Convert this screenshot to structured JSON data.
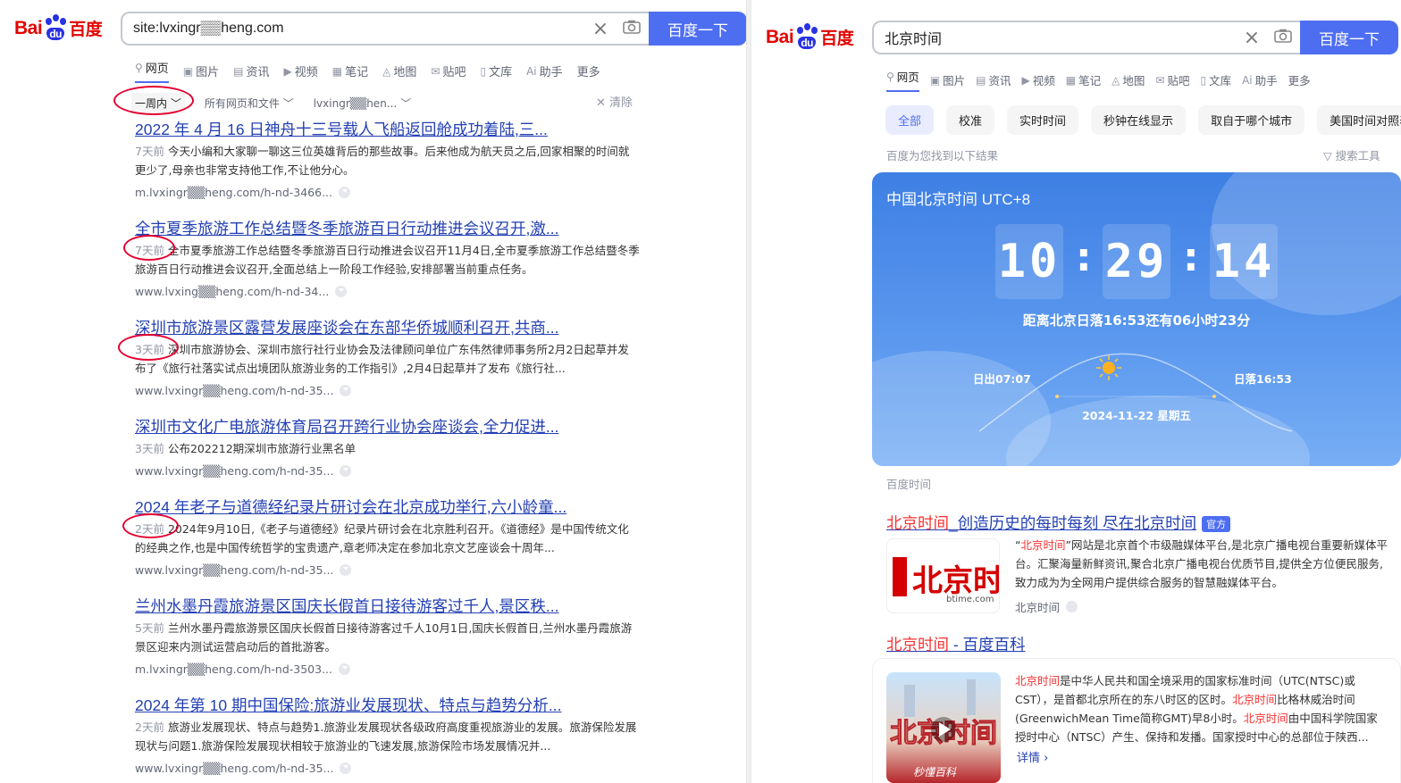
{
  "left": {
    "logo": {
      "bai": "Bai",
      "du": "du",
      "baidu": "百度"
    },
    "search": {
      "value": "site:lvxingr▒▒heng.com",
      "button": "百度一下"
    },
    "tabs": [
      {
        "icon": "○",
        "label": "网页",
        "active": true
      },
      {
        "icon": "▣",
        "label": "图片"
      },
      {
        "icon": "▤",
        "label": "资讯"
      },
      {
        "icon": "▶",
        "label": "视频"
      },
      {
        "icon": "▦",
        "label": "笔记"
      },
      {
        "icon": "◬",
        "label": "地图"
      },
      {
        "icon": "✉",
        "label": "贴吧"
      },
      {
        "icon": "▯",
        "label": "文库"
      },
      {
        "icon": "Ai",
        "label": "助手"
      },
      {
        "icon": "",
        "label": "更多"
      }
    ],
    "filters": {
      "time": "一周内",
      "scope": "所有网页和文件",
      "site": "lvxingr▒▒hen...",
      "clear": "清除"
    },
    "results": [
      {
        "title": "2022 年 4 月 16 日神舟十三号载人飞船返回舱成功着陆,三...",
        "ago": "7天前",
        "desc": "今天小编和大家聊一聊这三位英雄背后的那些故事。后来他成为航天员之后,回家相聚的时间就更少了,母亲也非常支持他工作,不让他分心。",
        "url": "m.lvxingr▒▒heng.com/h-nd-3466..."
      },
      {
        "title": "全市夏季旅游工作总结暨冬季旅游百日行动推进会议召开,激...",
        "ago": "7天前",
        "desc": "全市夏季旅游工作总结暨冬季旅游百日行动推进会议召开11月4日,全市夏季旅游工作总结暨冬季旅游百日行动推进会议召开,全面总结上一阶段工作经验,安排部署当前重点任务。",
        "url": "www.lvxing▒▒heng.com/h-nd-34..."
      },
      {
        "title": "深圳市旅游景区露营发展座谈会在东部华侨城顺利召开,共商...",
        "ago": "3天前",
        "desc": "深圳市旅游协会、深圳市旅行社行业协会及法律顾问单位广东伟然律师事务所2月2日起草并发布了《旅行社落实试点出境团队旅游业务的工作指引》,2月4日起草并了发布《旅行社...",
        "url": "www.lvxingr▒▒heng.com/h-nd-35..."
      },
      {
        "title": "深圳市文化广电旅游体育局召开跨行业协会座谈会,全力促进...",
        "ago": "3天前",
        "desc": "公布202212期深圳市旅游行业黑名单",
        "url": "www.lvxingr▒▒heng.com/h-nd-35..."
      },
      {
        "title": "2024 年老子与道德经纪录片研讨会在北京成功举行,六小龄童...",
        "ago": "2天前",
        "desc": "2024年9月10日,《老子与道德经》纪录片研讨会在北京胜利召开。《道德经》是中国传统文化的经典之作,也是中国传统哲学的宝贵遗产,章老师决定在参加北京文艺座谈会十周年...",
        "url": "www.lvxingr▒▒heng.com/h-nd-35..."
      },
      {
        "title": "兰州水墨丹霞旅游景区国庆长假首日接待游客过千人,景区秩...",
        "ago": "5天前",
        "desc": "兰州水墨丹霞旅游景区国庆长假首日接待游客过千人10月1日,国庆长假首日,兰州水墨丹霞旅游景区迎来内测试运营启动后的首批游客。",
        "url": "m.lvxingr▒▒heng.com/h-nd-3503..."
      },
      {
        "title": "2024 年第 10 期中国保险:旅游业发展现状、特点与趋势分析...",
        "ago": "2天前",
        "desc": "旅游业发展现状、特点与趋势1.旅游业发展现状各级政府高度重视旅游业的发展。旅游保险发展现状与问题1.旅游保险发展现状相较于旅游业的飞速发展,旅游保险市场发展情况并...",
        "url": "www.lvxingr▒▒heng.com/h-nd-35..."
      }
    ]
  },
  "right": {
    "logo": {
      "bai": "Bai",
      "du": "du",
      "baidu": "百度"
    },
    "search": {
      "value": "北京时间",
      "button": "百度一下"
    },
    "tabs": [
      {
        "icon": "○",
        "label": "网页",
        "active": true
      },
      {
        "icon": "▣",
        "label": "图片"
      },
      {
        "icon": "▤",
        "label": "资讯"
      },
      {
        "icon": "▶",
        "label": "视频"
      },
      {
        "icon": "▦",
        "label": "笔记"
      },
      {
        "icon": "◬",
        "label": "地图"
      },
      {
        "icon": "✉",
        "label": "贴吧"
      },
      {
        "icon": "▯",
        "label": "文库"
      },
      {
        "icon": "Ai",
        "label": "助手"
      },
      {
        "icon": "",
        "label": "更多"
      }
    ],
    "chips": [
      "全部",
      "校准",
      "实时时间",
      "秒钟在线显示",
      "取自于哪个城市",
      "美国时间对照表"
    ],
    "found": "百度为您找到以下结果",
    "tools": "搜索工具",
    "clock": {
      "title": "中国北京时间 UTC+8",
      "hh": "10",
      "mm": "29",
      "ss": "14",
      "sunset_note": "距离北京日落16:53还有06小时23分",
      "sunrise": "日出07:07",
      "sunset": "日落16:53",
      "date": "2024-11-22   星期五"
    },
    "clock_source": "百度时间",
    "r1": {
      "title_hl": "北京时间",
      "title_rest": "_创造历史的每时每刻 尽在北京时间",
      "badge": "官方",
      "desc_hl": "北京时间",
      "desc_pre": "“",
      "desc_post": "”网站是北京首个市级融媒体平台,是北京广播电视台重要新媒体平台。汇聚海量新鲜资讯,聚合北京广播电视台优质节目,提供全方位便民服务,致力成为为全网用户提供综合服务的智慧融媒体平台。",
      "site": "北京时间",
      "logo_text": "北京时间",
      "logo_sub": "btime.com"
    },
    "r2": {
      "title_hl": "北京时间",
      "title_rest": " - 百度百科",
      "hl": "北京时间",
      "p1": "是中华人民共和国全境采用的国家标准时间（UTC(NTSC)或CST），是首都北京所在的东八时区的区时。",
      "p2": "比格林威治时间(GreenwichMean Time简称GMT)早8小时。",
      "p3": "由中国科学院国家授时中心（NTSC）产生、保持和发播。国家授时中心的总部位于陕西...",
      "more": "详情 ›",
      "thumb_text": "北京时间",
      "thumb_sub": "秒懂百科"
    }
  }
}
